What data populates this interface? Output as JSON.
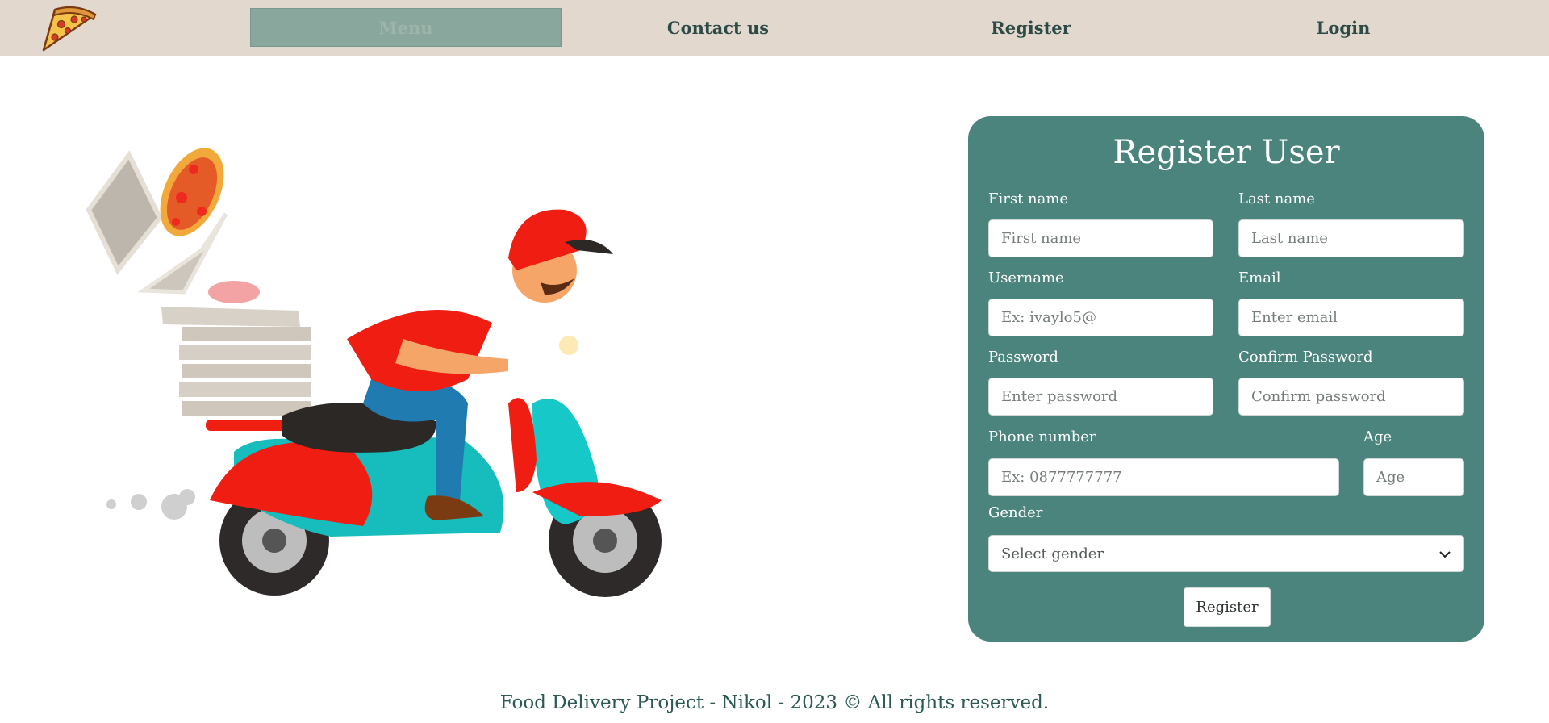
{
  "nav": {
    "menu": "Menu",
    "contact": "Contact us",
    "register": "Register",
    "login": "Login"
  },
  "form": {
    "title": "Register User",
    "first_name_label": "First name",
    "first_name_placeholder": "First name",
    "last_name_label": "Last name",
    "last_name_placeholder": "Last name",
    "username_label": "Username",
    "username_placeholder": "Ex: ivaylo5@",
    "email_label": "Email",
    "email_placeholder": "Enter email",
    "password_label": "Password",
    "password_placeholder": "Enter password",
    "confirm_label": "Confirm Password",
    "confirm_placeholder": "Confirm password",
    "phone_label": "Phone number",
    "phone_placeholder": "Ex: 0877777777",
    "age_label": "Age",
    "age_placeholder": "Age",
    "gender_label": "Gender",
    "gender_selected": "Select gender",
    "submit": "Register"
  },
  "footer": "Food Delivery Project - Nikol - 2023 © All rights reserved.",
  "colors": {
    "nav_bg": "#e3d8cd",
    "card_bg": "#4b847c",
    "menu_active_bg": "#8aa79d",
    "text_dark": "#2c4a46"
  },
  "icons": {
    "logo": "pizza-slice-icon",
    "select_arrow": "chevron-down-icon"
  }
}
